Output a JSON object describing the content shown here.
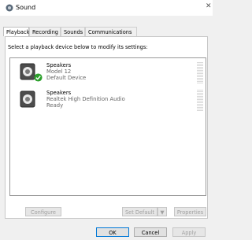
{
  "window": {
    "title": "Sound"
  },
  "tabs": [
    {
      "label": "Playback",
      "active": true
    },
    {
      "label": "Recording",
      "active": false
    },
    {
      "label": "Sounds",
      "active": false
    },
    {
      "label": "Communications",
      "active": false
    }
  ],
  "playback": {
    "instruction": "Select a playback device below to modify its settings:",
    "devices": [
      {
        "name": "Speakers",
        "line2": "Model 12",
        "line3": "Default Device",
        "is_default": true
      },
      {
        "name": "Speakers",
        "line2": "Realtek High Definition Audio",
        "line3": "Ready",
        "is_default": false
      }
    ],
    "buttons": {
      "configure": "Configure",
      "set_default": "Set Default",
      "properties": "Properties"
    }
  },
  "dialog_buttons": {
    "ok": "OK",
    "cancel": "Cancel",
    "apply": "Apply"
  },
  "colors": {
    "accent": "#0078d7",
    "default_check": "#2ca02c"
  }
}
